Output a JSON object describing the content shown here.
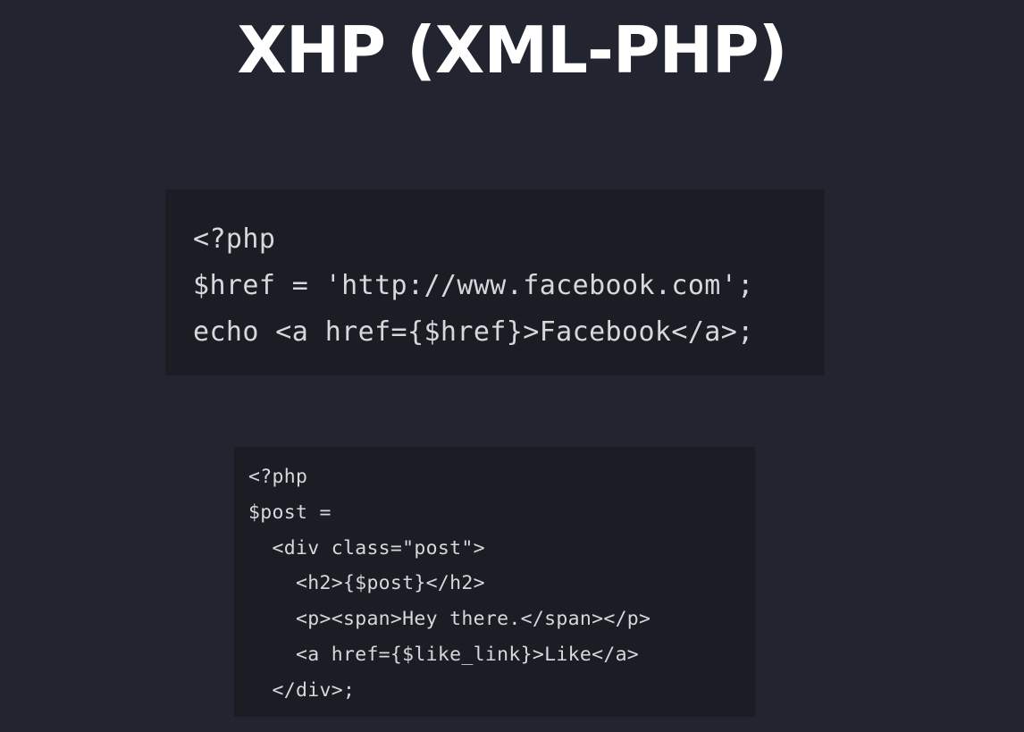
{
  "slide": {
    "title": "XHP (XML-PHP)"
  },
  "code_blocks": [
    {
      "lines": [
        "<?php",
        "$href = 'http://www.facebook.com';",
        "echo <a href={$href}>Facebook</a>;"
      ]
    },
    {
      "lines": [
        "<?php",
        "$post =",
        "  <div class=\"post\">",
        "    <h2>{$post}</h2>",
        "    <p><span>Hey there.</span></p>",
        "    <a href={$like_link}>Like</a>",
        "  </div>;"
      ]
    }
  ],
  "colors": {
    "background": "#22242f",
    "code_background": "#1b1c24",
    "code_text": "#d7d8dc",
    "title_text": "#ffffff"
  }
}
